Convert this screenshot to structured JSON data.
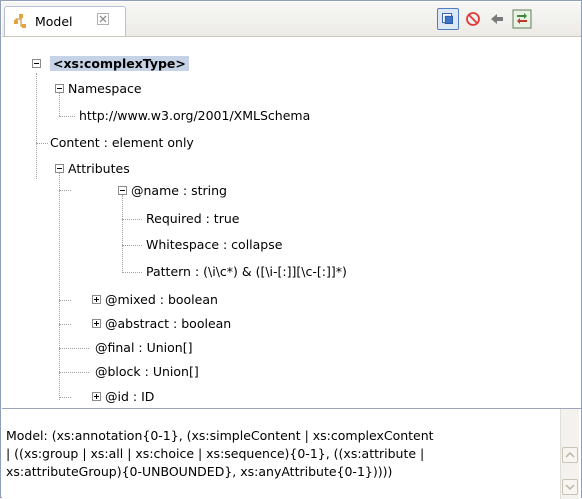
{
  "tab": {
    "title": "Model",
    "icon": "model-tree-icon"
  },
  "toolbar": {
    "buttons": [
      {
        "icon": "attributes-toggle-icon",
        "pressed": true
      },
      {
        "icon": "stop-icon"
      },
      {
        "icon": "back-arrow-icon"
      },
      {
        "icon": "sync-icon"
      }
    ]
  },
  "tree": {
    "root": "<xs:complexType>",
    "namespace": "Namespace",
    "namespace_value": "http://www.w3.org/2001/XMLSchema",
    "content": "Content : element only",
    "attributes": "Attributes",
    "attr_name": "@name : string",
    "required": "Required : true",
    "whitespace": "Whitespace : collapse",
    "pattern": "Pattern : (\\i\\c*) & ([\\i-[:]][\\c-[:]]*)",
    "mixed": "@mixed : boolean",
    "abstract": "@abstract : boolean",
    "final": "@final : Union[]",
    "block": "@block : Union[]",
    "id": "@id : ID"
  },
  "description": {
    "line1": "Model: (xs:annotation{0-1}, (xs:simpleContent | xs:complexContent",
    "line2": "| ((xs:group | xs:all | xs:choice | xs:sequence){0-1}, ((xs:attribute |",
    "line3": "xs:attributeGroup){0-UNBOUNDED}, xs:anyAttribute{0-1}))))"
  }
}
